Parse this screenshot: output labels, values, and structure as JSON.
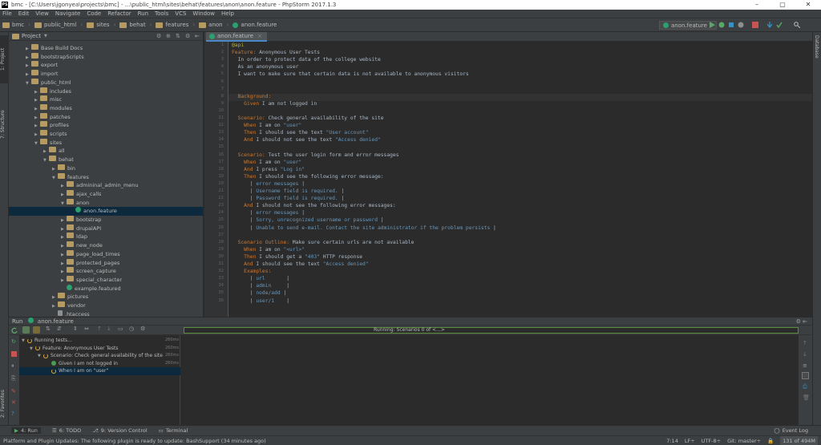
{
  "window": {
    "title": "bmc - [C:\\Users\\jgonyea\\projects\\bmc] - ...\\public_html\\sites\\behat\\features\\anon\\anon.feature - PhpStorm 2017.1.3",
    "logo": "PS"
  },
  "menu": [
    "File",
    "Edit",
    "View",
    "Navigate",
    "Code",
    "Refactor",
    "Run",
    "Tools",
    "VCS",
    "Window",
    "Help"
  ],
  "breadcrumbs": [
    "bmc",
    "public_html",
    "sites",
    "behat",
    "features",
    "anon",
    "anon.feature"
  ],
  "run_config": "anon.feature",
  "project_panel": {
    "title": "Project",
    "items": [
      {
        "label": "Base Build Docs",
        "depth": 1,
        "expanded": false
      },
      {
        "label": "bootstrapScripts",
        "depth": 1,
        "expanded": false
      },
      {
        "label": "export",
        "depth": 1,
        "expanded": false
      },
      {
        "label": "import",
        "depth": 1,
        "expanded": false
      },
      {
        "label": "public_html",
        "depth": 1,
        "expanded": true
      },
      {
        "label": "includes",
        "depth": 2,
        "expanded": false
      },
      {
        "label": "misc",
        "depth": 2,
        "expanded": false
      },
      {
        "label": "modules",
        "depth": 2,
        "expanded": false
      },
      {
        "label": "patches",
        "depth": 2,
        "expanded": false
      },
      {
        "label": "profiles",
        "depth": 2,
        "expanded": false
      },
      {
        "label": "scripts",
        "depth": 2,
        "expanded": false
      },
      {
        "label": "sites",
        "depth": 2,
        "expanded": true
      },
      {
        "label": "all",
        "depth": 3,
        "expanded": false
      },
      {
        "label": "behat",
        "depth": 3,
        "expanded": true
      },
      {
        "label": "bin",
        "depth": 4,
        "expanded": false
      },
      {
        "label": "features",
        "depth": 4,
        "expanded": true
      },
      {
        "label": "admininal_admin_menu",
        "depth": 5,
        "expanded": false
      },
      {
        "label": "ajax_calls",
        "depth": 5,
        "expanded": false
      },
      {
        "label": "anon",
        "depth": 5,
        "expanded": true
      },
      {
        "label": "anon.feature",
        "depth": 6,
        "file": true,
        "selected": true
      },
      {
        "label": "bootstrap",
        "depth": 5,
        "expanded": false
      },
      {
        "label": "drupalAPI",
        "depth": 5,
        "expanded": false
      },
      {
        "label": "ldap",
        "depth": 5,
        "expanded": false
      },
      {
        "label": "new_node",
        "depth": 5,
        "expanded": false
      },
      {
        "label": "page_load_times",
        "depth": 5,
        "expanded": false
      },
      {
        "label": "protected_pages",
        "depth": 5,
        "expanded": false
      },
      {
        "label": "screen_capture",
        "depth": 5,
        "expanded": false
      },
      {
        "label": "special_character",
        "depth": 5,
        "expanded": false
      },
      {
        "label": "example.featured",
        "depth": 5,
        "file": true
      },
      {
        "label": "pictures",
        "depth": 4,
        "expanded": false
      },
      {
        "label": "vendor",
        "depth": 4,
        "expanded": false
      },
      {
        "label": ".htaccess",
        "depth": 4,
        "file": true
      }
    ]
  },
  "editor": {
    "tab": "anon.feature",
    "lines": [
      [
        [
          "tag",
          "@api"
        ]
      ],
      [
        [
          "kw",
          "Feature:"
        ],
        [
          "txt",
          " Anonymous User Tests"
        ]
      ],
      [
        [
          "txt",
          "  In order to protect data of the college website"
        ]
      ],
      [
        [
          "txt",
          "  As an anonymous user"
        ]
      ],
      [
        [
          "txt",
          "  I want to make sure that certain data is not available to anonymous visitors"
        ]
      ],
      [
        [
          "txt",
          ""
        ]
      ],
      [
        [
          "txt",
          ""
        ]
      ],
      [
        [
          "kw",
          "  Background:"
        ]
      ],
      [
        [
          "kw",
          "    Given"
        ],
        [
          "txt",
          " I am not logged in"
        ]
      ],
      [
        [
          "txt",
          ""
        ]
      ],
      [
        [
          "kw",
          "  Scenario:"
        ],
        [
          "txt",
          " Check general availability of the site"
        ]
      ],
      [
        [
          "kw",
          "    When"
        ],
        [
          "txt",
          " I am on "
        ],
        [
          "tblc",
          "\"user\""
        ]
      ],
      [
        [
          "kw",
          "    Then"
        ],
        [
          "txt",
          " I should see the text "
        ],
        [
          "tblc",
          "\"User account\""
        ]
      ],
      [
        [
          "kw",
          "    And"
        ],
        [
          "txt",
          " I should not see the text "
        ],
        [
          "tblc",
          "\"Access denied\""
        ]
      ],
      [
        [
          "txt",
          ""
        ]
      ],
      [
        [
          "kw",
          "  Scenario:"
        ],
        [
          "txt",
          " Test the user login form and error messages"
        ]
      ],
      [
        [
          "kw",
          "    When"
        ],
        [
          "txt",
          " I am on "
        ],
        [
          "tblc",
          "\"user\""
        ]
      ],
      [
        [
          "kw",
          "    And"
        ],
        [
          "txt",
          " I press "
        ],
        [
          "tblc",
          "\"Log in\""
        ]
      ],
      [
        [
          "kw",
          "    Then"
        ],
        [
          "txt",
          " I should see the following error message:"
        ]
      ],
      [
        [
          "txt",
          "      | "
        ],
        [
          "tblc",
          "error messages"
        ],
        [
          "txt",
          " |"
        ]
      ],
      [
        [
          "txt",
          "      | "
        ],
        [
          "tblc",
          "Username field is required."
        ],
        [
          "txt",
          " |"
        ]
      ],
      [
        [
          "txt",
          "      | "
        ],
        [
          "tblc",
          "Password field is required."
        ],
        [
          "txt",
          " |"
        ]
      ],
      [
        [
          "kw",
          "    And"
        ],
        [
          "txt",
          " I should not see the following error messages:"
        ]
      ],
      [
        [
          "txt",
          "      | "
        ],
        [
          "tblc",
          "error messages"
        ],
        [
          "txt",
          " |"
        ]
      ],
      [
        [
          "txt",
          "      | "
        ],
        [
          "tblc",
          "Sorry, unrecognized username or password"
        ],
        [
          "txt",
          " |"
        ]
      ],
      [
        [
          "txt",
          "      | "
        ],
        [
          "tblc",
          "Unable to send e-mail. Contact the site administrator if the problem persists"
        ],
        [
          "txt",
          " |"
        ]
      ],
      [
        [
          "txt",
          ""
        ]
      ],
      [
        [
          "kw",
          "  Scenario Outline:"
        ],
        [
          "txt",
          " Make sure certain urls are not available"
        ]
      ],
      [
        [
          "kw",
          "    When"
        ],
        [
          "txt",
          " I am on "
        ],
        [
          "tblc",
          "\"<url>\""
        ]
      ],
      [
        [
          "kw",
          "    Then"
        ],
        [
          "txt",
          " I should get a "
        ],
        [
          "tblc",
          "\"403\""
        ],
        [
          "txt",
          " HTTP response"
        ]
      ],
      [
        [
          "kw",
          "    And"
        ],
        [
          "txt",
          " I should see the text "
        ],
        [
          "tblc",
          "\"Access denied\""
        ]
      ],
      [
        [
          "kw",
          "    Examples:"
        ]
      ],
      [
        [
          "txt",
          "      | "
        ],
        [
          "tblc",
          "url"
        ],
        [
          "txt",
          "       |"
        ]
      ],
      [
        [
          "txt",
          "      | "
        ],
        [
          "tblc",
          "admin"
        ],
        [
          "txt",
          "     |"
        ]
      ],
      [
        [
          "txt",
          "      | "
        ],
        [
          "tblc",
          "node/add"
        ],
        [
          "txt",
          " |"
        ]
      ],
      [
        [
          "txt",
          "      | "
        ],
        [
          "tblc",
          "user/1"
        ],
        [
          "txt",
          "    |"
        ]
      ]
    ]
  },
  "run_panel": {
    "title": "Run",
    "config": "anon.feature",
    "status": "Running: Scenarios 0 of <...>",
    "tree": [
      {
        "label": "Running tests...",
        "depth": 0,
        "state": "running",
        "time": "260ms"
      },
      {
        "label": "Feature: Anonymous User Tests",
        "depth": 1,
        "state": "running",
        "time": "260ms"
      },
      {
        "label": "Scenario: Check general availability of the site",
        "depth": 2,
        "state": "running",
        "time": "260ms"
      },
      {
        "label": "Given I am not logged in",
        "depth": 3,
        "state": "passed",
        "time": "260ms"
      },
      {
        "label": "When I am on \"user\"",
        "depth": 3,
        "state": "running",
        "time": "",
        "selected": true
      }
    ]
  },
  "bottom_tabs": [
    "4: Run",
    "6: TODO",
    "9: Version Control",
    "Terminal"
  ],
  "event_log": "Event Log",
  "status": {
    "message": "Platform and Plugin Updates: The following plugin is ready to update: BashSupport (34 minutes ago)",
    "position": "7:14",
    "line_sep": "LF÷",
    "encoding": "UTF-8÷",
    "git": "Git: master÷",
    "memory": "131 of 494M"
  },
  "side_tabs": {
    "project": "1: Project",
    "structure": "7: Structure",
    "favorites": "2: Favorites",
    "database": "Database"
  }
}
